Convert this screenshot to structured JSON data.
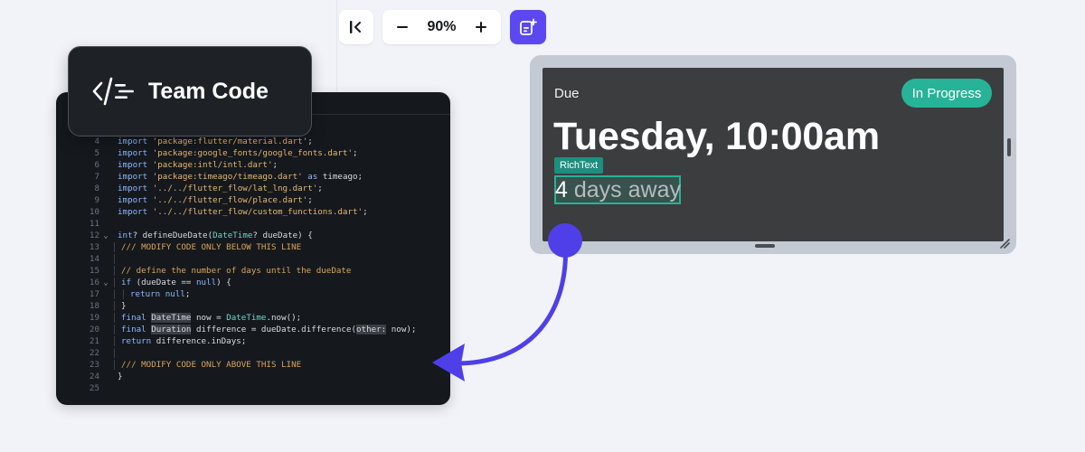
{
  "toolbar": {
    "zoom_value": "90%",
    "icons": {
      "collapse": "collapse-panel-icon",
      "zoom_out": "minus-icon",
      "zoom_in": "plus-icon",
      "add_widget": "add-widget-icon"
    }
  },
  "badge": {
    "label": "Team Code",
    "icon": "code-icon"
  },
  "code_editor": {
    "lines": [
      {
        "n": "4",
        "tokens": [
          [
            "kw",
            "import "
          ],
          [
            "str",
            "'package:flutter/material.dart'"
          ],
          [
            "",
            "; "
          ]
        ]
      },
      {
        "n": "5",
        "tokens": [
          [
            "kw",
            "import "
          ],
          [
            "str",
            "'package:google_fonts/google_fonts.dart'"
          ],
          [
            "",
            ";"
          ]
        ]
      },
      {
        "n": "6",
        "tokens": [
          [
            "kw",
            "import "
          ],
          [
            "str",
            "'package:intl/intl.dart'"
          ],
          [
            "",
            ";"
          ]
        ]
      },
      {
        "n": "7",
        "tokens": [
          [
            "kw",
            "import "
          ],
          [
            "str",
            "'package:timeago/timeago.dart'"
          ],
          [
            "kw",
            " as "
          ],
          [
            "",
            "timeago;"
          ]
        ]
      },
      {
        "n": "8",
        "tokens": [
          [
            "kw",
            "import "
          ],
          [
            "str",
            "'../../flutter_flow/lat_lng.dart'"
          ],
          [
            "",
            ";"
          ]
        ]
      },
      {
        "n": "9",
        "tokens": [
          [
            "kw",
            "import "
          ],
          [
            "str",
            "'../../flutter_flow/place.dart'"
          ],
          [
            "",
            ";"
          ]
        ]
      },
      {
        "n": "10",
        "tokens": [
          [
            "kw",
            "import "
          ],
          [
            "str",
            "'../../flutter_flow/custom_functions.dart'"
          ],
          [
            "",
            ";"
          ]
        ]
      },
      {
        "n": "11",
        "tokens": []
      },
      {
        "n": "12",
        "fold": "⌄",
        "tokens": [
          [
            "kw",
            "int"
          ],
          [
            "",
            "? defineDueDate("
          ],
          [
            "ty",
            "DateTime"
          ],
          [
            "",
            "? dueDate) {"
          ]
        ]
      },
      {
        "n": "13",
        "indent": 1,
        "tokens": [
          [
            "cmt",
            "/// MODIFY CODE ONLY BELOW THIS LINE"
          ]
        ]
      },
      {
        "n": "14",
        "indent": 1,
        "tokens": []
      },
      {
        "n": "15",
        "indent": 1,
        "tokens": [
          [
            "cmt",
            "// define the number of days until the dueDate"
          ]
        ]
      },
      {
        "n": "16",
        "fold": "⌄",
        "indent": 1,
        "tokens": [
          [
            "kw",
            "if "
          ],
          [
            "",
            "(dueDate == "
          ],
          [
            "kw",
            "null"
          ],
          [
            "",
            ") {"
          ]
        ]
      },
      {
        "n": "17",
        "indent": 2,
        "tokens": [
          [
            "kw",
            "return "
          ],
          [
            "kw",
            "null"
          ],
          [
            "",
            ";"
          ]
        ]
      },
      {
        "n": "18",
        "indent": 1,
        "tokens": [
          [
            "",
            "}"
          ]
        ]
      },
      {
        "n": "19",
        "indent": 1,
        "tokens": [
          [
            "kw",
            "final "
          ],
          [
            "hl",
            "DateTime"
          ],
          [
            "",
            " now = "
          ],
          [
            "ty",
            "DateTime"
          ],
          [
            "",
            ".now();"
          ]
        ]
      },
      {
        "n": "20",
        "indent": 1,
        "tokens": [
          [
            "kw",
            "final "
          ],
          [
            "hl",
            "Duration"
          ],
          [
            "",
            " difference = dueDate.difference("
          ],
          [
            "hl",
            "other:"
          ],
          [
            "",
            " now);"
          ]
        ]
      },
      {
        "n": "21",
        "indent": 1,
        "tokens": [
          [
            "kw",
            "return "
          ],
          [
            "",
            "difference.inDays;"
          ]
        ]
      },
      {
        "n": "22",
        "indent": 1,
        "tokens": []
      },
      {
        "n": "23",
        "indent": 1,
        "tokens": [
          [
            "cmt",
            "/// MODIFY CODE ONLY ABOVE THIS LINE"
          ]
        ]
      },
      {
        "n": "24",
        "tokens": [
          [
            "",
            "}"
          ]
        ]
      },
      {
        "n": "25",
        "tokens": []
      }
    ]
  },
  "preview": {
    "due_label": "Due",
    "status": "In Progress",
    "due_time": "Tuesday, 10:00am",
    "rich_text_tag": "RichText",
    "days_number": "4",
    "days_suffix": " days away",
    "icons": {
      "resize": "resize-handle-icon"
    }
  },
  "colors": {
    "accent": "#5b48f0",
    "status_bg": "#27b397",
    "code_bg": "#15191d"
  }
}
